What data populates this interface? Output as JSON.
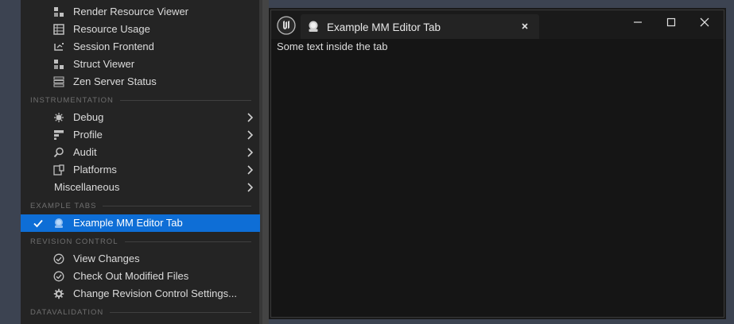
{
  "menu": {
    "items_top": [
      {
        "label": "Render Resource Viewer",
        "icon": "blocks-icon"
      },
      {
        "label": "Resource Usage",
        "icon": "table-icon"
      },
      {
        "label": "Session Frontend",
        "icon": "frontend-icon"
      },
      {
        "label": "Struct Viewer",
        "icon": "blocks-icon"
      },
      {
        "label": "Zen Server Status",
        "icon": "server-icon"
      }
    ],
    "section_instrumentation": "INSTRUMENTATION",
    "items_instrumentation": [
      {
        "label": "Debug",
        "icon": "bug-icon",
        "submenu": true
      },
      {
        "label": "Profile",
        "icon": "profile-icon",
        "submenu": true
      },
      {
        "label": "Audit",
        "icon": "audit-icon",
        "submenu": true
      },
      {
        "label": "Platforms",
        "icon": "platforms-icon",
        "submenu": true
      },
      {
        "label": "Miscellaneous",
        "submenu": true
      }
    ],
    "section_example_tabs": "EXAMPLE TABS",
    "selected_item": {
      "label": "Example MM Editor Tab",
      "icon": "tab-icon",
      "checked": true
    },
    "section_revision_control": "REVISION CONTROL",
    "items_revision": [
      {
        "label": "View Changes",
        "icon": "check-circle-icon"
      },
      {
        "label": "Check Out Modified Files",
        "icon": "check-circle-icon"
      },
      {
        "label": "Change Revision Control Settings...",
        "icon": "gear-icon"
      }
    ],
    "section_datavalidation": "DATAVALIDATION"
  },
  "window": {
    "tab_label": "Example MM Editor Tab",
    "content_text": "Some text inside the tab"
  },
  "colors": {
    "accent": "#0e6ed6",
    "menu_bg": "#242424",
    "window_bg": "#151515"
  }
}
